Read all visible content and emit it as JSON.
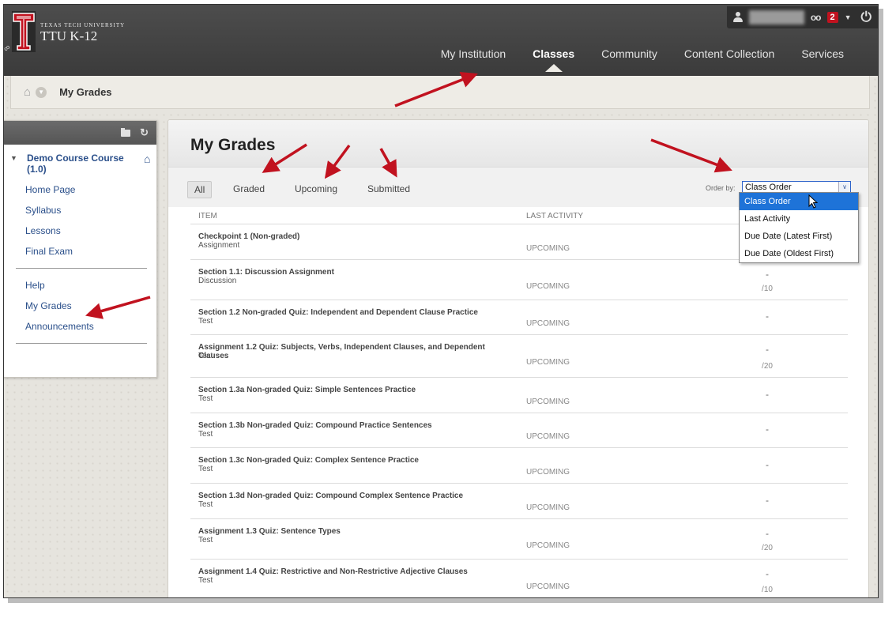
{
  "colors": {
    "accent_red": "#c1121f",
    "link_blue": "#2a4f8a",
    "select_blue": "#1e73d8",
    "header_dark": "#444444"
  },
  "header": {
    "logo_sub": "TEXAS TECH UNIVERSITY",
    "logo_title": "TTU K-12",
    "notification_count": "2",
    "nav": [
      {
        "label": "My Institution"
      },
      {
        "label": "Classes",
        "active": true
      },
      {
        "label": "Community"
      },
      {
        "label": "Content Collection"
      },
      {
        "label": "Services"
      }
    ]
  },
  "breadcrumb": {
    "title": "My Grades"
  },
  "sidebar": {
    "course_title": "Demo Course Course (1.0)",
    "course_links": [
      "Home Page",
      "Syllabus",
      "Lessons",
      "Final Exam"
    ],
    "tool_links": [
      "Help",
      "My Grades",
      "Announcements"
    ]
  },
  "main": {
    "title": "My Grades",
    "filters": [
      "All",
      "Graded",
      "Upcoming",
      "Submitted"
    ],
    "order_by_label": "Order by:",
    "order_by_value": "Class Order",
    "order_options": [
      "Class Order",
      "Last Activity",
      "Due Date (Latest First)",
      "Due Date (Oldest First)"
    ],
    "columns": {
      "item": "ITEM",
      "last_activity": "LAST ACTIVITY"
    },
    "rows": [
      {
        "name": "Checkpoint 1 (Non-graded)",
        "type": "Assignment",
        "activity": "UPCOMING",
        "grade": "",
        "possible": ""
      },
      {
        "name": "Section 1.1: Discussion Assignment",
        "type": "Discussion",
        "activity": "UPCOMING",
        "grade": "-",
        "possible": "/10"
      },
      {
        "name": "Section 1.2 Non-graded Quiz: Independent and Dependent Clause Practice",
        "type": "Test",
        "activity": "UPCOMING",
        "grade": "-",
        "possible": ""
      },
      {
        "name": "Assignment 1.2 Quiz: Subjects, Verbs, Independent Clauses, and Dependent Clauses",
        "type": "Test",
        "activity": "UPCOMING",
        "grade": "-",
        "possible": "/20"
      },
      {
        "name": "Section 1.3a Non-graded Quiz: Simple Sentences Practice",
        "type": "Test",
        "activity": "UPCOMING",
        "grade": "-",
        "possible": ""
      },
      {
        "name": "Section 1.3b Non-graded Quiz: Compound Practice Sentences",
        "type": "Test",
        "activity": "UPCOMING",
        "grade": "-",
        "possible": ""
      },
      {
        "name": "Section 1.3c Non-graded Quiz: Complex Sentence Practice",
        "type": "Test",
        "activity": "UPCOMING",
        "grade": "-",
        "possible": ""
      },
      {
        "name": "Section 1.3d Non-graded Quiz: Compound Complex Sentence Practice",
        "type": "Test",
        "activity": "UPCOMING",
        "grade": "-",
        "possible": ""
      },
      {
        "name": "Assignment 1.3 Quiz: Sentence Types",
        "type": "Test",
        "activity": "UPCOMING",
        "grade": "-",
        "possible": "/20"
      },
      {
        "name": "Assignment 1.4 Quiz: Restrictive and Non-Restrictive Adjective Clauses",
        "type": "Test",
        "activity": "UPCOMING",
        "grade": "-",
        "possible": "/10"
      }
    ]
  }
}
